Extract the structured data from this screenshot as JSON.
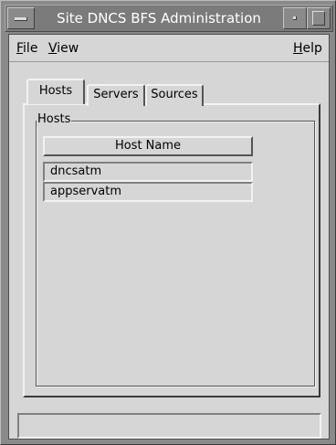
{
  "window": {
    "title": "Site DNCS BFS Administration"
  },
  "menubar": {
    "file": {
      "mnemonic": "F",
      "rest": "ile"
    },
    "view": {
      "mnemonic": "V",
      "rest": "iew"
    },
    "help": {
      "mnemonic": "H",
      "rest": "elp"
    }
  },
  "tabs": [
    {
      "label": "Hosts",
      "selected": true
    },
    {
      "label": "Servers",
      "selected": false
    },
    {
      "label": "Sources",
      "selected": false
    }
  ],
  "hosts_panel": {
    "group_label": "Hosts",
    "column_header": "Host Name",
    "rows": [
      "dncsatm",
      "appservatm"
    ]
  },
  "statusbar": {
    "text": ""
  }
}
